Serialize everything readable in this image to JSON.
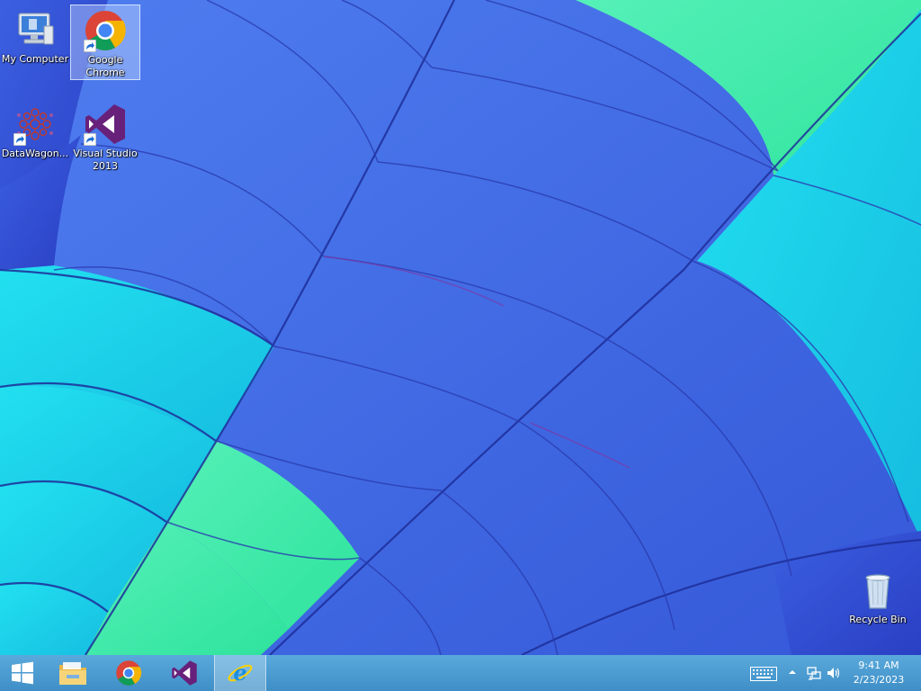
{
  "desktop": {
    "icons": [
      {
        "id": "my-computer",
        "label": "My Computer",
        "icon": "computer-icon",
        "selected": false
      },
      {
        "id": "google-chrome",
        "label": "Google Chrome",
        "icon": "chrome-icon",
        "selected": true,
        "shortcut": true
      },
      {
        "id": "datawagon",
        "label": "DataWagon...",
        "icon": "datawagon-icon",
        "selected": false,
        "shortcut": true
      },
      {
        "id": "visual-studio",
        "label": "Visual Studio 2013",
        "icon": "visual-studio-icon",
        "selected": false,
        "shortcut": true
      },
      {
        "id": "recycle-bin",
        "label": "Recycle Bin",
        "icon": "recycle-bin-icon",
        "selected": false
      }
    ]
  },
  "taskbar": {
    "buttons": [
      {
        "name": "start-button",
        "icon": "windows-logo-icon"
      },
      {
        "name": "file-explorer-button",
        "icon": "folder-icon"
      },
      {
        "name": "chrome-taskbar-button",
        "icon": "chrome-icon"
      },
      {
        "name": "visual-studio-taskbar-button",
        "icon": "visual-studio-icon"
      },
      {
        "name": "internet-explorer-taskbar-button",
        "icon": "internet-explorer-icon",
        "active": true
      }
    ],
    "tray": {
      "icons": [
        "keyboard-icon",
        "show-hidden-icons-chevron",
        "network-icon",
        "volume-icon"
      ],
      "time": "9:41 AM",
      "date": "2/23/2023"
    }
  },
  "colors": {
    "wallpaper_blue": "#3f6ae6",
    "wallpaper_cyan": "#1fd6ee",
    "wallpaper_green": "#3de8a6",
    "taskbar": "#4a9dd3",
    "visual_studio_purple": "#68217a"
  }
}
